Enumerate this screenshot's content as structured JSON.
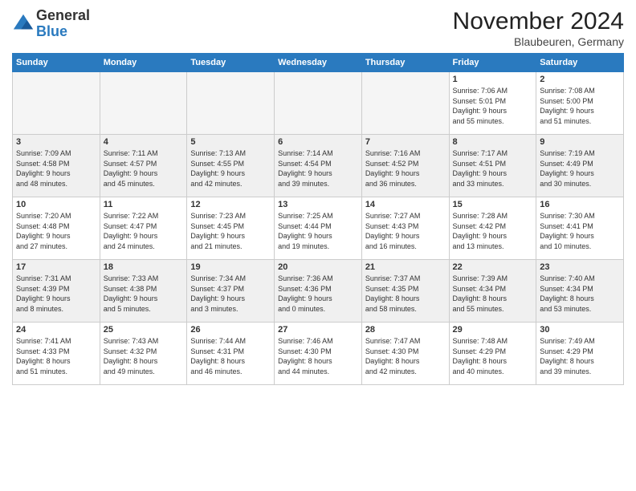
{
  "logo": {
    "general": "General",
    "blue": "Blue"
  },
  "title": "November 2024",
  "location": "Blaubeuren, Germany",
  "days_header": [
    "Sunday",
    "Monday",
    "Tuesday",
    "Wednesday",
    "Thursday",
    "Friday",
    "Saturday"
  ],
  "weeks": [
    [
      {
        "day": "",
        "detail": "",
        "empty": true
      },
      {
        "day": "",
        "detail": "",
        "empty": true
      },
      {
        "day": "",
        "detail": "",
        "empty": true
      },
      {
        "day": "",
        "detail": "",
        "empty": true
      },
      {
        "day": "",
        "detail": "",
        "empty": true
      },
      {
        "day": "1",
        "detail": "Sunrise: 7:06 AM\nSunset: 5:01 PM\nDaylight: 9 hours\nand 55 minutes."
      },
      {
        "day": "2",
        "detail": "Sunrise: 7:08 AM\nSunset: 5:00 PM\nDaylight: 9 hours\nand 51 minutes."
      }
    ],
    [
      {
        "day": "3",
        "detail": "Sunrise: 7:09 AM\nSunset: 4:58 PM\nDaylight: 9 hours\nand 48 minutes."
      },
      {
        "day": "4",
        "detail": "Sunrise: 7:11 AM\nSunset: 4:57 PM\nDaylight: 9 hours\nand 45 minutes."
      },
      {
        "day": "5",
        "detail": "Sunrise: 7:13 AM\nSunset: 4:55 PM\nDaylight: 9 hours\nand 42 minutes."
      },
      {
        "day": "6",
        "detail": "Sunrise: 7:14 AM\nSunset: 4:54 PM\nDaylight: 9 hours\nand 39 minutes."
      },
      {
        "day": "7",
        "detail": "Sunrise: 7:16 AM\nSunset: 4:52 PM\nDaylight: 9 hours\nand 36 minutes."
      },
      {
        "day": "8",
        "detail": "Sunrise: 7:17 AM\nSunset: 4:51 PM\nDaylight: 9 hours\nand 33 minutes."
      },
      {
        "day": "9",
        "detail": "Sunrise: 7:19 AM\nSunset: 4:49 PM\nDaylight: 9 hours\nand 30 minutes."
      }
    ],
    [
      {
        "day": "10",
        "detail": "Sunrise: 7:20 AM\nSunset: 4:48 PM\nDaylight: 9 hours\nand 27 minutes."
      },
      {
        "day": "11",
        "detail": "Sunrise: 7:22 AM\nSunset: 4:47 PM\nDaylight: 9 hours\nand 24 minutes."
      },
      {
        "day": "12",
        "detail": "Sunrise: 7:23 AM\nSunset: 4:45 PM\nDaylight: 9 hours\nand 21 minutes."
      },
      {
        "day": "13",
        "detail": "Sunrise: 7:25 AM\nSunset: 4:44 PM\nDaylight: 9 hours\nand 19 minutes."
      },
      {
        "day": "14",
        "detail": "Sunrise: 7:27 AM\nSunset: 4:43 PM\nDaylight: 9 hours\nand 16 minutes."
      },
      {
        "day": "15",
        "detail": "Sunrise: 7:28 AM\nSunset: 4:42 PM\nDaylight: 9 hours\nand 13 minutes."
      },
      {
        "day": "16",
        "detail": "Sunrise: 7:30 AM\nSunset: 4:41 PM\nDaylight: 9 hours\nand 10 minutes."
      }
    ],
    [
      {
        "day": "17",
        "detail": "Sunrise: 7:31 AM\nSunset: 4:39 PM\nDaylight: 9 hours\nand 8 minutes."
      },
      {
        "day": "18",
        "detail": "Sunrise: 7:33 AM\nSunset: 4:38 PM\nDaylight: 9 hours\nand 5 minutes."
      },
      {
        "day": "19",
        "detail": "Sunrise: 7:34 AM\nSunset: 4:37 PM\nDaylight: 9 hours\nand 3 minutes."
      },
      {
        "day": "20",
        "detail": "Sunrise: 7:36 AM\nSunset: 4:36 PM\nDaylight: 9 hours\nand 0 minutes."
      },
      {
        "day": "21",
        "detail": "Sunrise: 7:37 AM\nSunset: 4:35 PM\nDaylight: 8 hours\nand 58 minutes."
      },
      {
        "day": "22",
        "detail": "Sunrise: 7:39 AM\nSunset: 4:34 PM\nDaylight: 8 hours\nand 55 minutes."
      },
      {
        "day": "23",
        "detail": "Sunrise: 7:40 AM\nSunset: 4:34 PM\nDaylight: 8 hours\nand 53 minutes."
      }
    ],
    [
      {
        "day": "24",
        "detail": "Sunrise: 7:41 AM\nSunset: 4:33 PM\nDaylight: 8 hours\nand 51 minutes."
      },
      {
        "day": "25",
        "detail": "Sunrise: 7:43 AM\nSunset: 4:32 PM\nDaylight: 8 hours\nand 49 minutes."
      },
      {
        "day": "26",
        "detail": "Sunrise: 7:44 AM\nSunset: 4:31 PM\nDaylight: 8 hours\nand 46 minutes."
      },
      {
        "day": "27",
        "detail": "Sunrise: 7:46 AM\nSunset: 4:30 PM\nDaylight: 8 hours\nand 44 minutes."
      },
      {
        "day": "28",
        "detail": "Sunrise: 7:47 AM\nSunset: 4:30 PM\nDaylight: 8 hours\nand 42 minutes."
      },
      {
        "day": "29",
        "detail": "Sunrise: 7:48 AM\nSunset: 4:29 PM\nDaylight: 8 hours\nand 40 minutes."
      },
      {
        "day": "30",
        "detail": "Sunrise: 7:49 AM\nSunset: 4:29 PM\nDaylight: 8 hours\nand 39 minutes."
      }
    ]
  ],
  "colors": {
    "header_bg": "#2a7abf",
    "shaded_row": "#f0f0f0",
    "empty_bg": "#f5f5f5"
  }
}
